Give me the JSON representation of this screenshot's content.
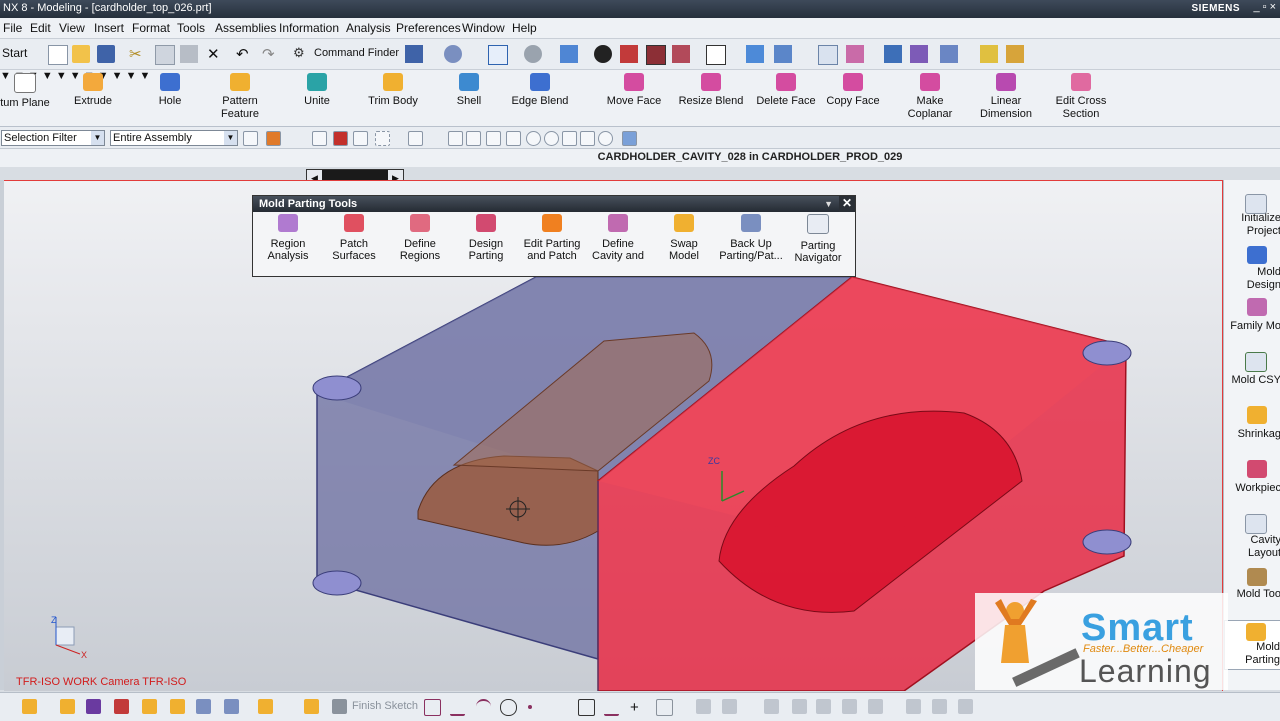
{
  "window": {
    "title": "NX 8 - Modeling - [cardholder_top_026.prt]",
    "brand": "SIEMENS",
    "controls": "_ ▫ ×"
  },
  "menu": [
    "File",
    "Edit",
    "View",
    "Insert",
    "Format",
    "Tools",
    "Assemblies",
    "Information",
    "Analysis",
    "Preferences",
    "Window",
    "Help"
  ],
  "toolbar": {
    "start_label": "Start",
    "command_finder_label": "Command Finder"
  },
  "ribbon": [
    {
      "label": "tum Plane"
    },
    {
      "label": "Extrude"
    },
    {
      "label": "Hole"
    },
    {
      "label": "Pattern\nFeature"
    },
    {
      "label": "Unite"
    },
    {
      "label": "Trim Body"
    },
    {
      "label": "Shell"
    },
    {
      "label": "Edge Blend"
    },
    {
      "label": "Move Face"
    },
    {
      "label": "Resize Blend"
    },
    {
      "label": "Delete Face"
    },
    {
      "label": "Copy Face"
    },
    {
      "label": "Make\nCoplanar"
    },
    {
      "label": "Linear\nDimension"
    },
    {
      "label": "Edit Cross\nSection"
    }
  ],
  "selection": {
    "filter": "Selection Filter",
    "scope": "Entire Assembly"
  },
  "work_part_title": "CARDHOLDER_CAVITY_028 in CARDHOLDER_PROD_029",
  "mold_parting_tools": {
    "title": "Mold Parting Tools",
    "items": [
      {
        "label": "Region\nAnalysis"
      },
      {
        "label": "Patch\nSurfaces"
      },
      {
        "label": "Define\nRegions"
      },
      {
        "label": "Design\nParting"
      },
      {
        "label": "Edit Parting\nand Patch"
      },
      {
        "label": "Define\nCavity and"
      },
      {
        "label": "Swap\nModel"
      },
      {
        "label": "Back Up\nParting/Pat..."
      },
      {
        "label": "Parting\nNavigator"
      }
    ]
  },
  "right_panel": [
    {
      "label": "Initialize\nProject"
    },
    {
      "label": "Mold\nDesign"
    },
    {
      "label": "Family Mo"
    },
    {
      "label": "Mold CSY"
    },
    {
      "label": "Shrinkag"
    },
    {
      "label": "Workpiec"
    },
    {
      "label": "Cavity\nLayout"
    },
    {
      "label": "Mold Too"
    },
    {
      "label": "Mold\nParting"
    }
  ],
  "viewport": {
    "camera_label": "TFR-ISO WORK Camera TFR-ISO",
    "triad_z": "Z",
    "triad_x": "X",
    "wcs_label": "ZC"
  },
  "sketch_toolbar": {
    "finish_sketch": "Finish Sketch"
  },
  "watermark": {
    "line1": "Smart",
    "tagline": "Faster...Better...Cheaper",
    "line2": "Learning"
  },
  "colors": {
    "cavity_red": "#e8253f",
    "core_blue": "#6f72a3",
    "part_copper": "#9a5a3e",
    "selection_border": "#e23b3b"
  }
}
